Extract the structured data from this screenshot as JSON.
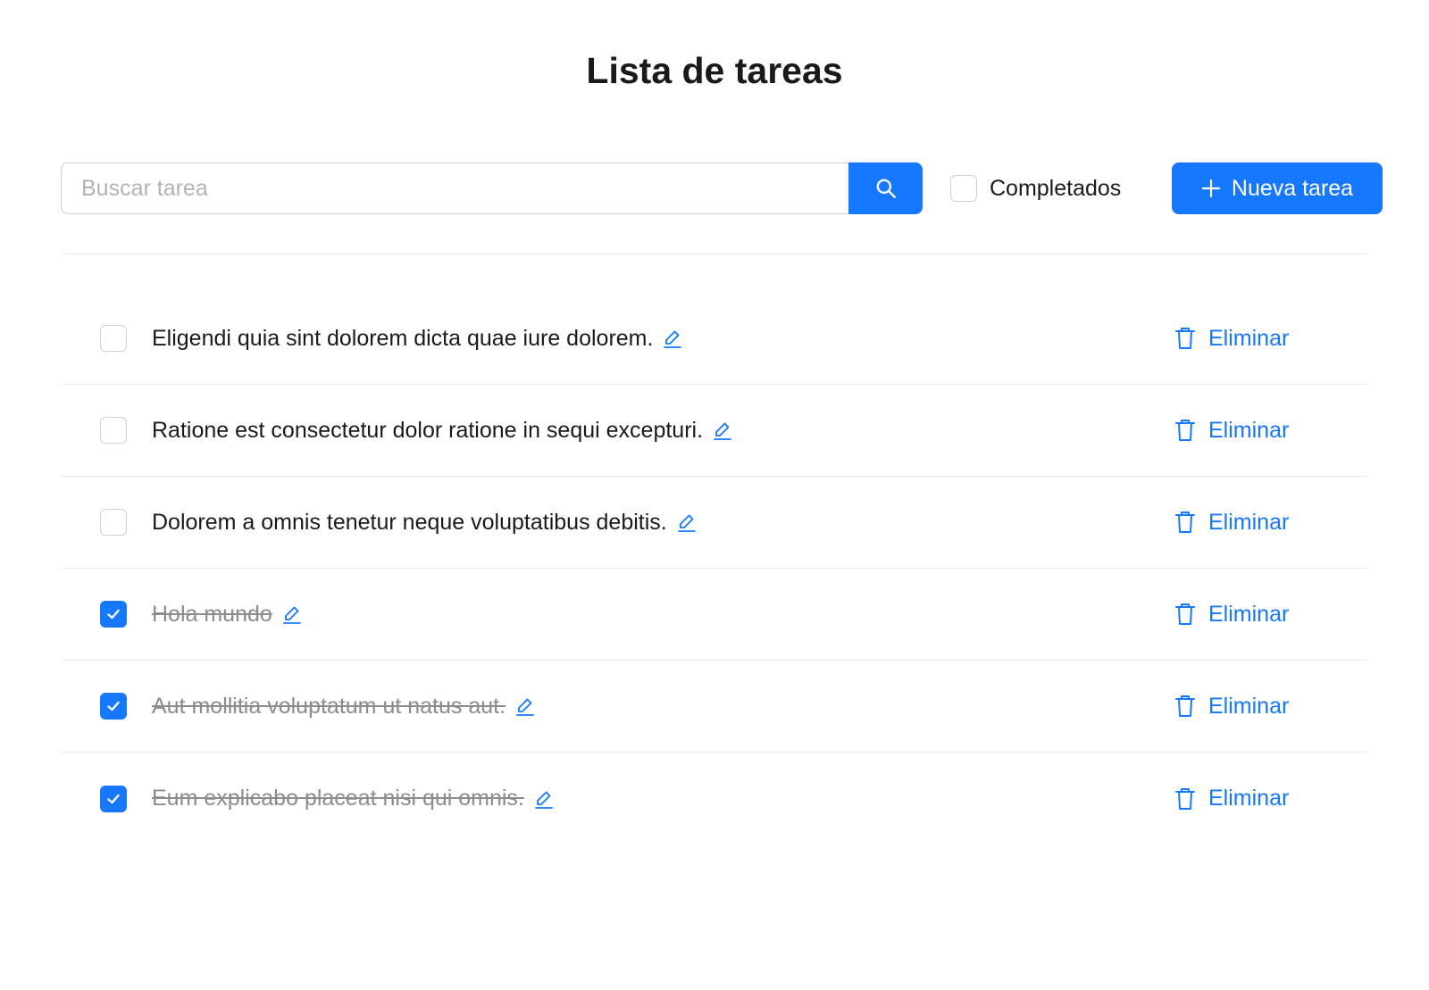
{
  "header": {
    "title": "Lista de tareas"
  },
  "search": {
    "placeholder": "Buscar tarea",
    "value": ""
  },
  "filter": {
    "completed_label": "Completados",
    "completed_checked": false
  },
  "toolbar": {
    "new_task_label": "Nueva tarea"
  },
  "tasks": [
    {
      "text": "Eligendi quia sint dolorem dicta quae iure dolorem.",
      "done": false,
      "delete_label": "Eliminar"
    },
    {
      "text": "Ratione est consectetur dolor ratione in sequi excepturi.",
      "done": false,
      "delete_label": "Eliminar"
    },
    {
      "text": "Dolorem a omnis tenetur neque voluptatibus debitis.",
      "done": false,
      "delete_label": "Eliminar"
    },
    {
      "text": "Hola mundo",
      "done": true,
      "delete_label": "Eliminar"
    },
    {
      "text": "Aut mollitia voluptatum ut natus aut.",
      "done": true,
      "delete_label": "Eliminar"
    },
    {
      "text": "Eum explicabo placeat nisi qui omnis.",
      "done": true,
      "delete_label": "Eliminar"
    }
  ],
  "icons": {
    "search": "search-icon",
    "plus": "plus-icon",
    "edit": "edit-icon",
    "delete": "trash-icon",
    "check": "check-icon"
  },
  "colors": {
    "accent": "#1677ff",
    "text": "#1a1a1a",
    "muted": "#8c8c8c",
    "border": "#d0d0d0",
    "divider": "#ececec"
  }
}
